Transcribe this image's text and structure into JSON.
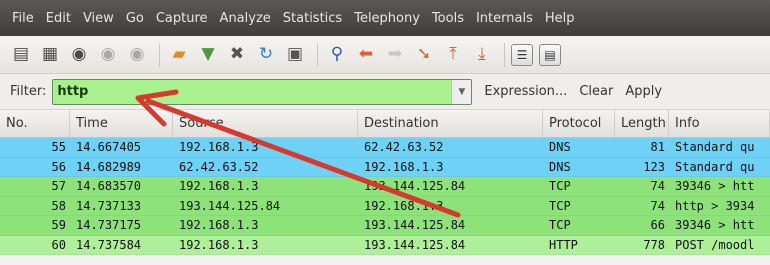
{
  "menubar": {
    "items": [
      "File",
      "Edit",
      "View",
      "Go",
      "Capture",
      "Analyze",
      "Statistics",
      "Telephony",
      "Tools",
      "Internals",
      "Help"
    ]
  },
  "toolbar": {
    "buttons": [
      {
        "icon": "interface-list-icon",
        "glyph": "▤",
        "color": "#4a4a4a"
      },
      {
        "icon": "capture-options-icon",
        "glyph": "▦",
        "color": "#4a4a4a"
      },
      {
        "icon": "capture-start-icon",
        "glyph": "◉",
        "color": "#4a4a4a"
      },
      {
        "icon": "capture-stop-icon",
        "glyph": "◉",
        "color": "#a8a8a8"
      },
      {
        "icon": "capture-restart-icon",
        "glyph": "◉",
        "color": "#a8a8a8"
      },
      {
        "icon": "open-file-icon",
        "glyph": "▰",
        "color": "#e08a2c"
      },
      {
        "icon": "save-file-icon",
        "glyph": "▼",
        "color": "#4e9a3a"
      },
      {
        "icon": "close-file-icon",
        "glyph": "✖",
        "color": "#555555"
      },
      {
        "icon": "reload-icon",
        "glyph": "↻",
        "color": "#3a7cc9"
      },
      {
        "icon": "print-icon",
        "glyph": "▣",
        "color": "#555555"
      },
      {
        "icon": "find-packet-icon",
        "glyph": "⚲",
        "color": "#2a5ea8"
      },
      {
        "icon": "go-back-icon",
        "glyph": "⬅",
        "color": "#e0602c"
      },
      {
        "icon": "go-forward-icon",
        "glyph": "➡",
        "color": "#c8c8c8"
      },
      {
        "icon": "go-to-packet-icon",
        "glyph": "➘",
        "color": "#e0602c"
      },
      {
        "icon": "first-packet-icon",
        "glyph": "⤒",
        "color": "#e0602c"
      },
      {
        "icon": "last-packet-icon",
        "glyph": "⤓",
        "color": "#e0602c"
      }
    ],
    "squares": [
      {
        "icon": "colorize-icon",
        "glyph": "☰"
      },
      {
        "icon": "auto-scroll-icon",
        "glyph": "▤"
      }
    ]
  },
  "filter": {
    "label": "Filter:",
    "value": "http",
    "expression_label": "Expression...",
    "clear_label": "Clear",
    "apply_label": "Apply"
  },
  "columns": [
    "No.",
    "Time",
    "Source",
    "Destination",
    "Protocol",
    "Length",
    "Info"
  ],
  "rows": [
    {
      "no": "55",
      "time": "14.667405",
      "src": "192.168.1.3",
      "dst": "62.42.63.52",
      "proto": "DNS",
      "len": "81",
      "info": "Standard qu",
      "bg": "#6dd2f5"
    },
    {
      "no": "56",
      "time": "14.682989",
      "src": "62.42.63.52",
      "dst": "192.168.1.3",
      "proto": "DNS",
      "len": "123",
      "info": "Standard qu",
      "bg": "#6dd2f5"
    },
    {
      "no": "57",
      "time": "14.683570",
      "src": "192.168.1.3",
      "dst": "193.144.125.84",
      "proto": "TCP",
      "len": "74",
      "info": "39346 > htt",
      "bg": "#8ee27a"
    },
    {
      "no": "58",
      "time": "14.737133",
      "src": "193.144.125.84",
      "dst": "192.168.1.3",
      "proto": "TCP",
      "len": "74",
      "info": "http > 3934",
      "bg": "#8ee27a"
    },
    {
      "no": "59",
      "time": "14.737175",
      "src": "192.168.1.3",
      "dst": "193.144.125.84",
      "proto": "TCP",
      "len": "66",
      "info": "39346 > htt",
      "bg": "#8ee27a"
    },
    {
      "no": "60",
      "time": "14.737584",
      "src": "192.168.1.3",
      "dst": "193.144.125.84",
      "proto": "HTTP",
      "len": "778",
      "info": "POST /moodl",
      "bg": "#aef09a"
    }
  ],
  "colors": {
    "arrow": "#d9382c",
    "dns_row": "#6dd2f5",
    "tcp_row": "#8ee27a",
    "filter_valid": "#a9f08e"
  }
}
